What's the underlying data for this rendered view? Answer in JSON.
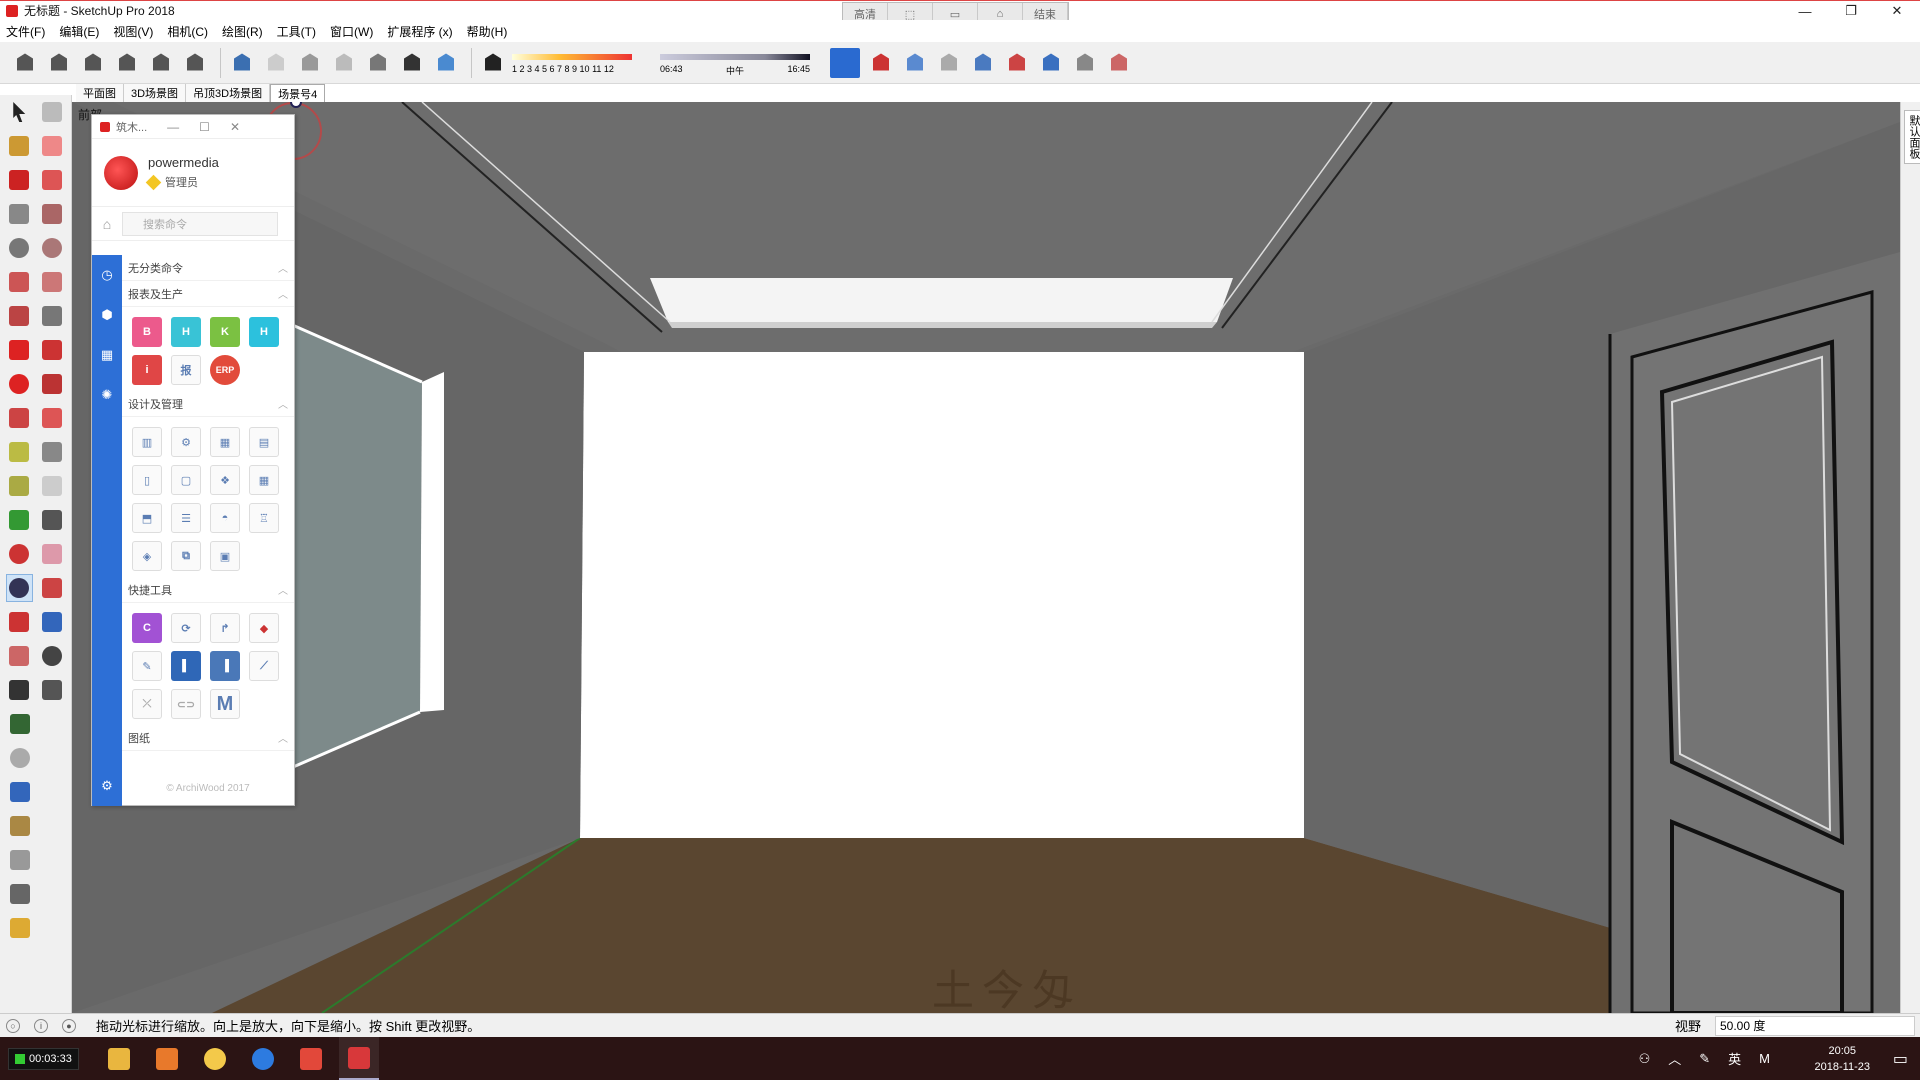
{
  "window": {
    "title": "无标题 - SketchUp Pro 2018",
    "controls": [
      "—",
      "❐",
      "✕"
    ]
  },
  "scene_controls": [
    "高清",
    "⬚",
    "▭",
    "⌂",
    "结束"
  ],
  "menu": [
    "文件(F)",
    "编辑(E)",
    "视图(V)",
    "相机(C)",
    "绘图(R)",
    "工具(T)",
    "窗口(W)",
    "扩展程序 (x)",
    "帮助(H)"
  ],
  "toolbar": {
    "shadow_ticks": "1 2 3 4 5 6 7 8 9 10 11 12",
    "time_start": "06:43",
    "time_mid": "中午",
    "time_end": "16:45"
  },
  "scene_tabs": [
    "平面图",
    "3D场景图",
    "吊顶3D场景图",
    "场景号4"
  ],
  "viewport": {
    "perspective_label": "前部",
    "watermark": "土今匁"
  },
  "tray_tab": "默认面板",
  "plugin": {
    "window_title": "筑木...",
    "user_name": "powermedia",
    "user_role": "管理员",
    "search_placeholder": "搜索命令",
    "sections": {
      "uncategorized": "无分类命令",
      "reports": "报表及生产",
      "design": "设计及管理",
      "quick": "快捷工具",
      "drawings": "图纸"
    },
    "report_icons": [
      "B",
      "H",
      "K",
      "H",
      "i",
      "报",
      "ERP"
    ],
    "quick_letters": [
      "C",
      "M"
    ],
    "copyright": "© ArchiWood 2017"
  },
  "status": {
    "message": "拖动光标进行缩放。向上是放大，向下是缩小。按 Shift 更改视野。",
    "field_label": "视野",
    "field_value": "50.00 度"
  },
  "taskbar": {
    "recorder_time": "00:03:33",
    "tray_input": "英",
    "tray_m": "M",
    "time": "20:05",
    "date": "2018-11-23"
  },
  "colors": {
    "accent_blue": "#2d6fd6",
    "floor_brown": "#5a4630",
    "wall_gray": "#6a6a6a"
  }
}
